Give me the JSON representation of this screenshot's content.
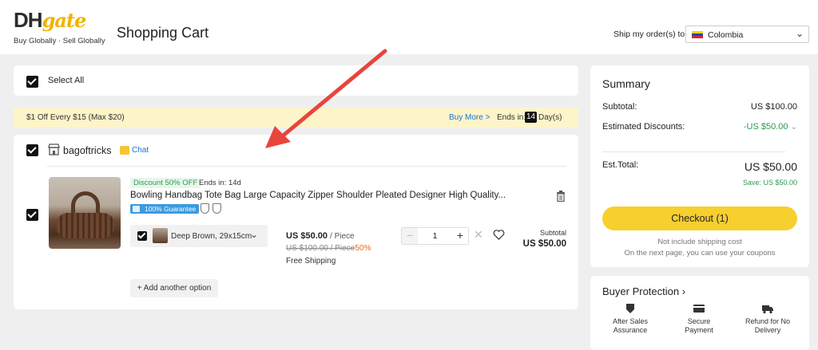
{
  "header": {
    "logo_main": "DH",
    "logo_accent": "gate",
    "tagline": "Buy Globally · Sell Globally",
    "page_title": "Shopping Cart",
    "ship_label": "Ship my order(s) to :",
    "country": "Colombia"
  },
  "cart": {
    "select_all": "Select All",
    "promo": {
      "text": "$1 Off Every $15 (Max $20)",
      "buy_more": "Buy More >",
      "ends_label": "Ends in:",
      "days": "14",
      "days_unit": "Day(s)"
    },
    "store": {
      "name": "bagoftricks",
      "chat": "Chat"
    },
    "item": {
      "discount_tag": "Discount 50% OFF",
      "discount_ends": "Ends in: 14d",
      "title": "Bowling Handbag Tote Bag Large Capacity Zipper Shoulder Pleated Designer High Quality...",
      "guarantee": "100% Guarantee",
      "variant": "Deep Brown, 29x15cm",
      "price": "US $50.00",
      "price_unit": "/ Piece",
      "old_price": "US $100.00 / Piece",
      "discount_pct": "-50%",
      "shipping": "Free Shipping",
      "quantity": "1",
      "subtotal_label": "Subtotal",
      "subtotal": "US $50.00"
    },
    "add_option": "+ Add another option"
  },
  "summary": {
    "title": "Summary",
    "subtotal_label": "Subtotal:",
    "subtotal": "US $100.00",
    "discounts_label": "Estimated Discounts:",
    "discounts": "-US $50.00",
    "total_label": "Est.Total:",
    "total": "US $50.00",
    "save": "Save: US $50.00",
    "checkout": "Checkout (1)",
    "note1": "Not include shipping cost",
    "note2": "On the next page, you can use your coupons"
  },
  "protection": {
    "title": "Buyer Protection",
    "items": [
      {
        "line1": "After Sales",
        "line2": "Assurance"
      },
      {
        "line1": "Secure",
        "line2": "Payment"
      },
      {
        "line1": "Refund for No",
        "line2": "Delivery"
      }
    ]
  },
  "colors": {
    "accent_yellow": "#f7cf2f",
    "link_blue": "#1b6fd1",
    "discount_green": "#2e9a4e",
    "annotation_red": "#e8453c"
  },
  "icons": [
    "store-icon",
    "chat-icon",
    "trash-icon",
    "shield-icon",
    "wishlist-icon",
    "after-sales-icon",
    "card-icon",
    "truck-icon"
  ]
}
